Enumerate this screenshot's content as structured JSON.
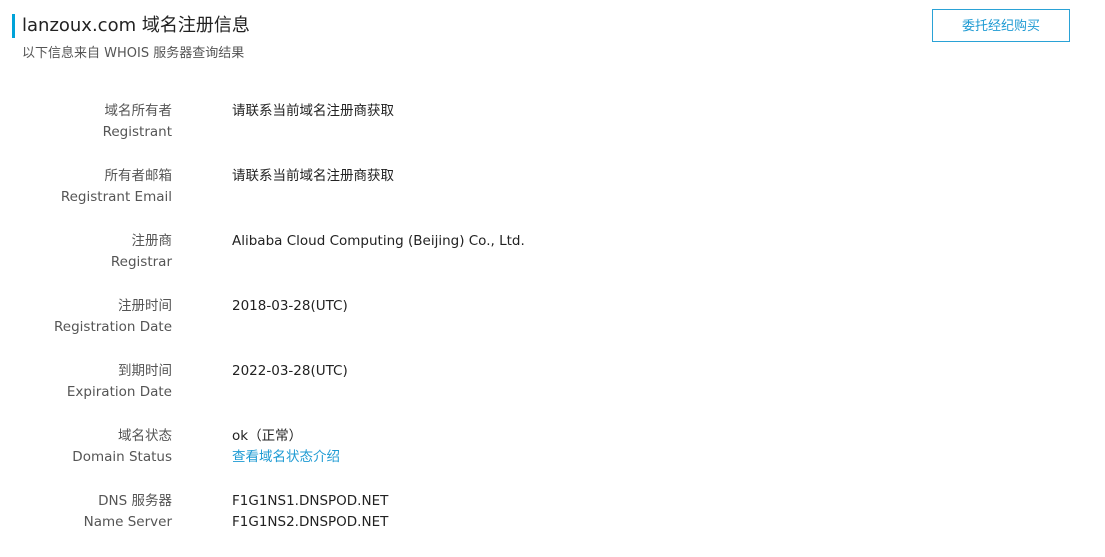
{
  "header": {
    "title": "lanzoux.com 域名注册信息",
    "subtitle": "以下信息来自 WHOIS 服务器查询结果",
    "broker_button": "委托经纪购买"
  },
  "whois": {
    "rows": [
      {
        "label_cn": "域名所有者",
        "label_en": "Registrant",
        "values": [
          "请联系当前域名注册商获取"
        ]
      },
      {
        "label_cn": "所有者邮箱",
        "label_en": "Registrant Email",
        "values": [
          "请联系当前域名注册商获取"
        ]
      },
      {
        "label_cn": "注册商",
        "label_en": "Registrar",
        "values": [
          "Alibaba Cloud Computing (Beijing) Co., Ltd."
        ]
      },
      {
        "label_cn": "注册时间",
        "label_en": "Registration Date",
        "values": [
          "2018-03-28(UTC)"
        ]
      },
      {
        "label_cn": "到期时间",
        "label_en": "Expiration Date",
        "values": [
          "2022-03-28(UTC)"
        ]
      },
      {
        "label_cn": "域名状态",
        "label_en": "Domain Status",
        "values": [
          "ok（正常）"
        ],
        "link": "查看域名状态介绍"
      },
      {
        "label_cn": "DNS 服务器",
        "label_en": "Name Server",
        "values": [
          "F1G1NS1.DNSPOD.NET",
          "F1G1NS2.DNSPOD.NET"
        ]
      }
    ]
  },
  "colors": {
    "accent": "#00a3d9",
    "link": "#1f9bd3"
  }
}
